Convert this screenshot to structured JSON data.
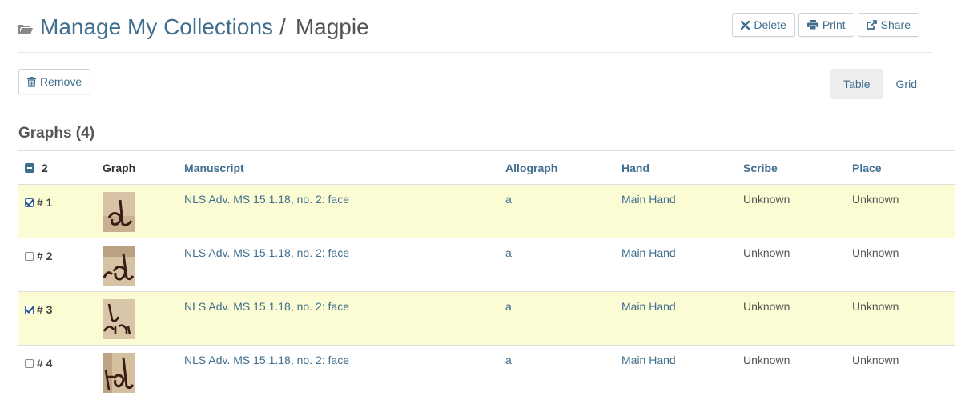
{
  "header": {
    "breadcrumb_parent": "Manage My Collections",
    "separator": "/",
    "collection_name": "Magpie"
  },
  "actions": {
    "delete_label": "Delete",
    "print_label": "Print",
    "share_label": "Share",
    "remove_label": "Remove"
  },
  "view_toggle": {
    "table_label": "Table",
    "grid_label": "Grid",
    "active": "Table"
  },
  "section_title": "Graphs (4)",
  "table": {
    "selected_count": "2",
    "columns": [
      "Graph",
      "Manuscript",
      "Allograph",
      "Hand",
      "Scribe",
      "Place"
    ],
    "rows": [
      {
        "id": "# 1",
        "checked": true,
        "manuscript": "NLS Adv. MS 15.1.18, no. 2: face",
        "allograph": "a",
        "hand": "Main Hand",
        "scribe": "Unknown",
        "place": "Unknown"
      },
      {
        "id": "# 2",
        "checked": false,
        "manuscript": "NLS Adv. MS 15.1.18, no. 2: face",
        "allograph": "a",
        "hand": "Main Hand",
        "scribe": "Unknown",
        "place": "Unknown"
      },
      {
        "id": "# 3",
        "checked": true,
        "manuscript": "NLS Adv. MS 15.1.18, no. 2: face",
        "allograph": "a",
        "hand": "Main Hand",
        "scribe": "Unknown",
        "place": "Unknown"
      },
      {
        "id": "# 4",
        "checked": false,
        "manuscript": "NLS Adv. MS 15.1.18, no. 2: face",
        "allograph": "a",
        "hand": "Main Hand",
        "scribe": "Unknown",
        "place": "Unknown"
      }
    ]
  },
  "icons": {
    "folder": "folder-open-icon",
    "delete": "times-icon",
    "print": "printer-icon",
    "share": "share-icon",
    "remove": "trash-icon"
  },
  "colors": {
    "link": "#3f6e8f",
    "selected_row": "#fcfcd4",
    "active_tab": "#eeeeee"
  }
}
